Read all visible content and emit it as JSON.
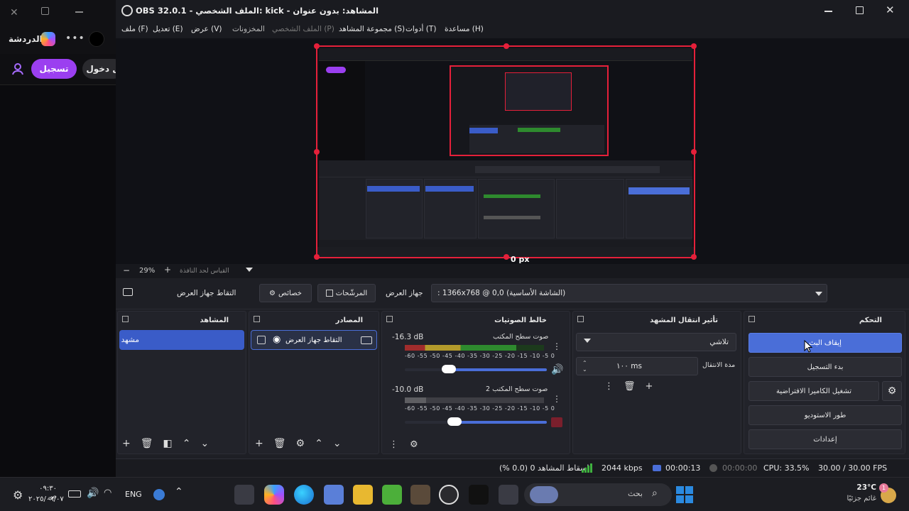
{
  "browser": {
    "chat_label": "الدردشة",
    "signup_label": "تسجيل",
    "login_label": "ل دخول"
  },
  "obs": {
    "title": "OBS 32.0.1 - الملف الشخصي: kick - المشاهد: بدون عنوان",
    "menu": [
      "ملف (F)",
      "تعديل (E)",
      "عرض (V)",
      "المخزونات",
      "الملف الشخصي (P)",
      "مجموعة المشاهد (S)",
      "أدوات (T)",
      "مساعدة (H)"
    ],
    "preview_px": "0 px",
    "zoom": {
      "value": "29%",
      "fit_label": "القياس لحد النافذة"
    },
    "source_toolbar": {
      "source_name": "التقاط جهاز العرض",
      "properties_label": "خصائص",
      "filters_label": "المرشّحات",
      "display_label": "جهاز العرض",
      "display_value": "(الشاشة الأساسية) 1366x768 @ 0,0 :"
    },
    "docks": {
      "scenes": {
        "title": "المشاهد",
        "items": [
          "مشهد"
        ]
      },
      "sources": {
        "title": "المصادر",
        "items": [
          "التقاط جهاز العرض"
        ]
      },
      "mixer": {
        "title": "خالط الصوتيات",
        "channels": [
          {
            "name": "صوت سطح المكتب",
            "db": "-16.3 dB",
            "level": 0.8,
            "volume": 0.86
          },
          {
            "name": "صوت سطح المكتب 2",
            "db": "-10.0 dB",
            "level": 0.0,
            "volume": 0.9
          }
        ],
        "ticks": "-60 -55 -50 -45 -40 -35 -30 -25 -20 -15 -10 -5 0"
      },
      "transitions": {
        "title": "تأثير انتقال المشهد",
        "selected": "تلاشي",
        "duration_label": "مدة الانتقال",
        "duration_value": "١٠٠ ms"
      },
      "controls": {
        "title": "التحكم",
        "stop_stream": "إيقاف البث",
        "start_recording": "بدء التسجيل",
        "virtual_camera": "تشغيل الكاميرا الافتراضية",
        "studio_mode": "طور الاستوديو",
        "settings": "إعدادات"
      }
    },
    "status": {
      "dropped": "إسقاط المشاهد 0 (0.0 %)",
      "bitrate": "2044 kbps",
      "stream_time": "00:00:13",
      "rec_time": "00:00:00",
      "cpu": "CPU: 33.5%",
      "fps": "30.00 / 30.00 FPS"
    }
  },
  "taskbar": {
    "time": "٠٩:٣٠ ص",
    "date": "٢٠٢٥/٠٩/٠٧",
    "lang": "ENG",
    "search_placeholder": "بحث",
    "weather_temp": "23°C",
    "weather_desc": "غائم جزئيًا",
    "notification_count": "1"
  },
  "colors": {
    "accent": "#4a6ed8",
    "live_red": "#e5203a",
    "kick_purple": "#8a2be2",
    "meter_green": "#2e8a2e",
    "meter_yellow": "#b39a2b",
    "meter_red": "#a02c2c"
  }
}
